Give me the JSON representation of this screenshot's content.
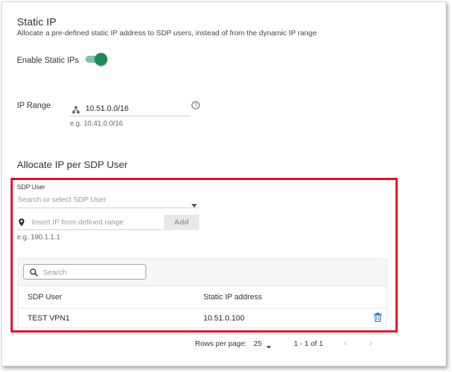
{
  "static_ip": {
    "title": "Static IP",
    "description": "Allocate a pre-defined static IP address to SDP users, instead of from the dynamic IP range",
    "enable_label": "Enable Static IPs",
    "enabled": true
  },
  "ip_range": {
    "label": "IP Range",
    "value": "10.51.0.0/16",
    "hint": "e.g. 10.41.0.0/16",
    "help_icon": "help-circle-icon",
    "field_icon": "network-icon"
  },
  "allocate": {
    "title": "Allocate IP per SDP User",
    "user_field_label": "SDP User",
    "user_placeholder": "Search or select SDP User",
    "ip_placeholder": "Insert IP from defined range",
    "ip_hint": "e.g. 190.1.1.1",
    "add_label": "Add",
    "highlight_color": "#e8001c"
  },
  "table": {
    "search_placeholder": "Search",
    "columns": [
      "SDP User",
      "Static IP address"
    ],
    "rows": [
      {
        "user": "TEST VPN1",
        "ip": "10.51.0.100"
      }
    ]
  },
  "pagination": {
    "rows_per_page_label": "Rows per page:",
    "rows_per_page": "25",
    "range": "1 - 1 of 1"
  },
  "colors": {
    "accent": "#1e8a5c",
    "delete_icon": "#2e6fb7"
  }
}
